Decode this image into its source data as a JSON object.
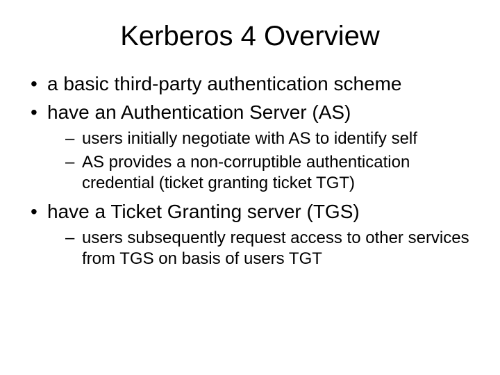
{
  "title": "Kerberos 4 Overview",
  "bullets": [
    {
      "text": "a basic third-party authentication scheme"
    },
    {
      "text": "have an Authentication Server (AS)",
      "sub": [
        "users initially negotiate with AS to identify self",
        "AS provides a non-corruptible authentication credential (ticket granting ticket TGT)"
      ]
    },
    {
      "text": "have a Ticket Granting server (TGS)",
      "sub": [
        "users subsequently request access to other services from TGS on basis of users TGT"
      ]
    }
  ]
}
